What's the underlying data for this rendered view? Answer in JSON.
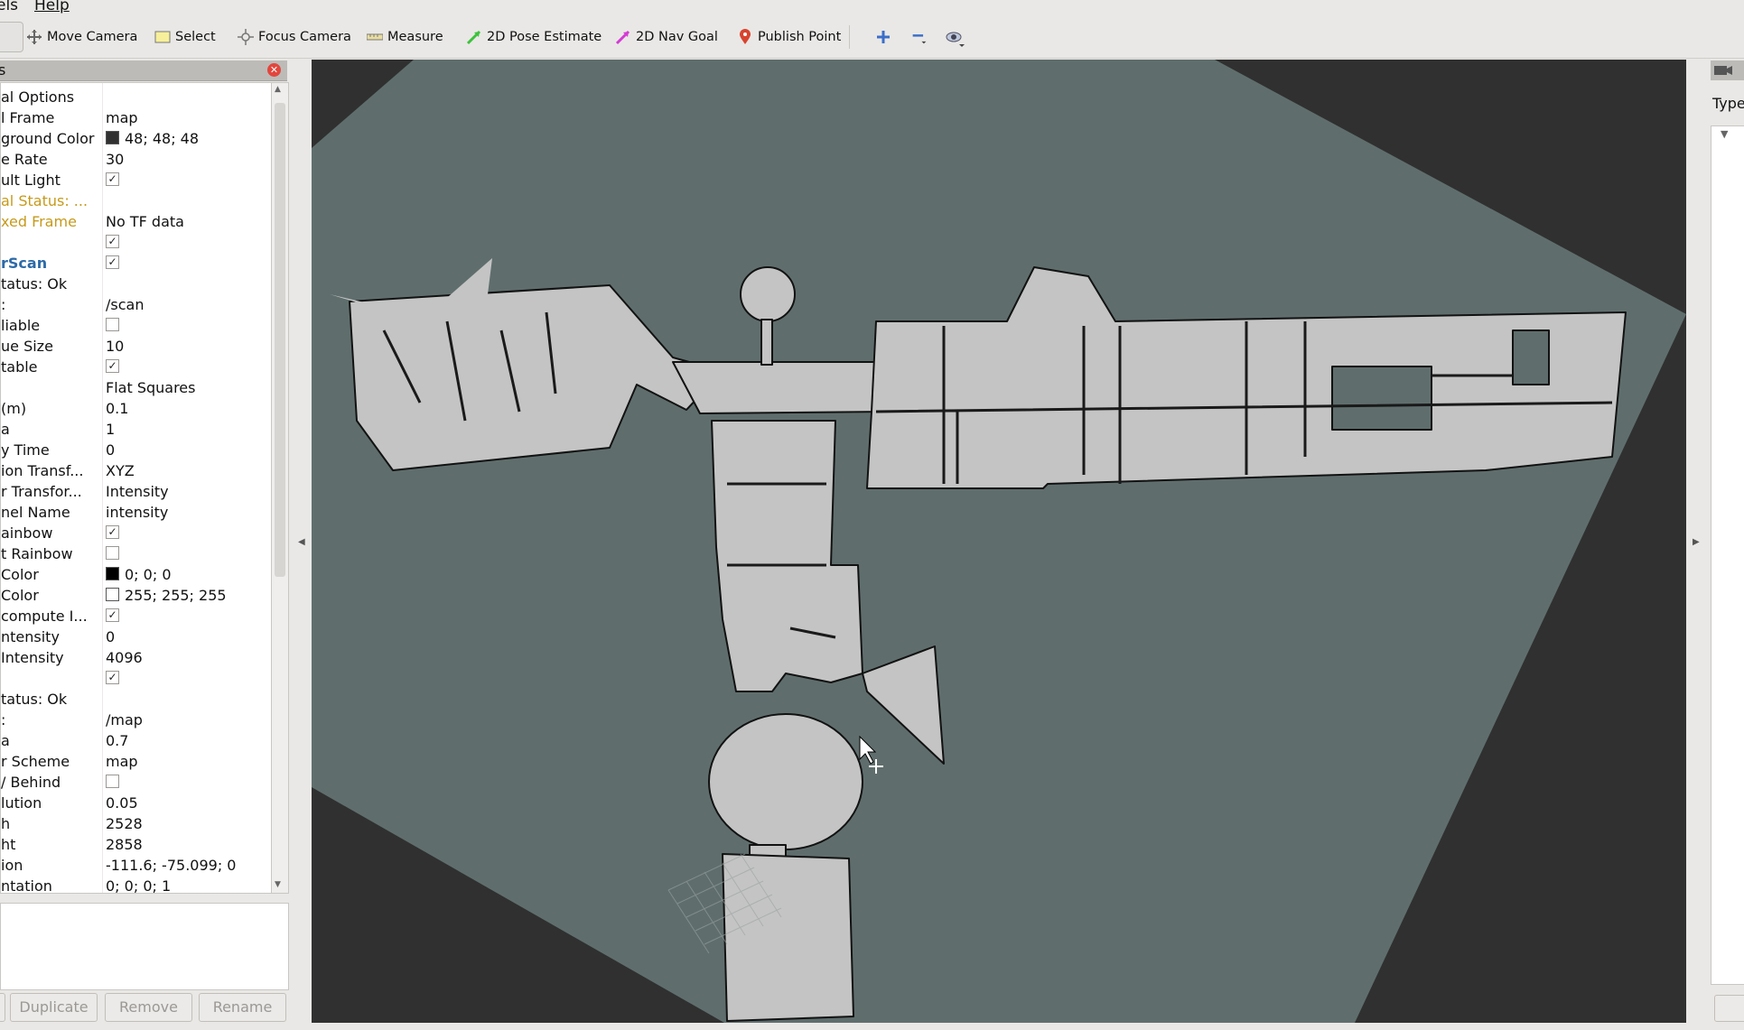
{
  "menu": {
    "views_partial": "els",
    "help": "Help"
  },
  "toolbar": {
    "move_camera": "Move Camera",
    "select": "Select",
    "focus_camera": "Focus Camera",
    "measure": "Measure",
    "pose_estimate": "2D Pose Estimate",
    "nav_goal": "2D Nav Goal",
    "publish_point": "Publish Point",
    "icons": [
      "move-camera-icon",
      "select-icon",
      "focus-camera-icon",
      "measure-icon",
      "pose-estimate-icon",
      "nav-goal-icon",
      "publish-point-icon",
      "zoom-in-icon",
      "zoom-out-icon",
      "eye-icon"
    ]
  },
  "displays": {
    "title": "s",
    "rows": [
      {
        "k": "al Options",
        "v": "",
        "type": "text",
        "style": "normal"
      },
      {
        "k": "l Frame",
        "v": "map",
        "type": "text"
      },
      {
        "k": "ground Color",
        "v": "48; 48; 48",
        "type": "color",
        "swatch": "#303030"
      },
      {
        "k": "e Rate",
        "v": "30",
        "type": "text"
      },
      {
        "k": "ult Light",
        "v": "",
        "type": "check",
        "checked": true
      },
      {
        "k": "al Status: ...",
        "v": "",
        "type": "text",
        "style": "warn"
      },
      {
        "k": "xed Frame",
        "v": "No TF data",
        "type": "text",
        "style": "warn"
      },
      {
        "k": "",
        "v": "",
        "type": "check",
        "checked": true
      },
      {
        "k": "rScan",
        "v": "",
        "type": "check",
        "checked": true,
        "style": "blue"
      },
      {
        "k": "tatus: Ok",
        "v": "",
        "type": "text"
      },
      {
        "k": ":",
        "v": "/scan",
        "type": "text"
      },
      {
        "k": "liable",
        "v": "",
        "type": "check",
        "checked": false
      },
      {
        "k": "ue Size",
        "v": "10",
        "type": "text"
      },
      {
        "k": "table",
        "v": "",
        "type": "check",
        "checked": true
      },
      {
        "k": "",
        "v": "Flat Squares",
        "type": "text"
      },
      {
        "k": "(m)",
        "v": "0.1",
        "type": "text"
      },
      {
        "k": "a",
        "v": "1",
        "type": "text"
      },
      {
        "k": "y Time",
        "v": "0",
        "type": "text"
      },
      {
        "k": "ion Transf...",
        "v": "XYZ",
        "type": "text"
      },
      {
        "k": "r Transfor...",
        "v": "Intensity",
        "type": "text"
      },
      {
        "k": "nel Name",
        "v": "intensity",
        "type": "text"
      },
      {
        "k": "ainbow",
        "v": "",
        "type": "check",
        "checked": true
      },
      {
        "k": "t Rainbow",
        "v": "",
        "type": "check",
        "checked": false
      },
      {
        "k": "Color",
        "v": "0; 0; 0",
        "type": "color",
        "swatch": "#000000"
      },
      {
        "k": "Color",
        "v": "255; 255; 255",
        "type": "color",
        "swatch": "#ffffff"
      },
      {
        "k": "compute I...",
        "v": "",
        "type": "check",
        "checked": true
      },
      {
        "k": "ntensity",
        "v": "0",
        "type": "text"
      },
      {
        "k": "Intensity",
        "v": "4096",
        "type": "text"
      },
      {
        "k": "",
        "v": "",
        "type": "check",
        "checked": true
      },
      {
        "k": "tatus: Ok",
        "v": "",
        "type": "text"
      },
      {
        "k": ":",
        "v": "/map",
        "type": "text"
      },
      {
        "k": "a",
        "v": "0.7",
        "type": "text"
      },
      {
        "k": "r Scheme",
        "v": "map",
        "type": "text"
      },
      {
        "k": "/ Behind",
        "v": "",
        "type": "check",
        "checked": false
      },
      {
        "k": "lution",
        "v": "0.05",
        "type": "text"
      },
      {
        "k": "h",
        "v": "2528",
        "type": "text"
      },
      {
        "k": "ht",
        "v": "2858",
        "type": "text"
      },
      {
        "k": "ion",
        "v": "-111.6; -75.099; 0",
        "type": "text"
      },
      {
        "k": "ntation",
        "v": "0; 0; 0; 1",
        "type": "text"
      }
    ],
    "buttons": {
      "duplicate": "Duplicate",
      "remove": "Remove",
      "rename": "Rename"
    }
  },
  "right_panel": {
    "type_label": "Type"
  },
  "colors": {
    "background": "#303030",
    "map_unknown": "#5f6e6d",
    "map_free": "#c4c4c4",
    "map_wall": "#111111",
    "warn": "#c69a1c",
    "blue": "#2d6aa8"
  }
}
